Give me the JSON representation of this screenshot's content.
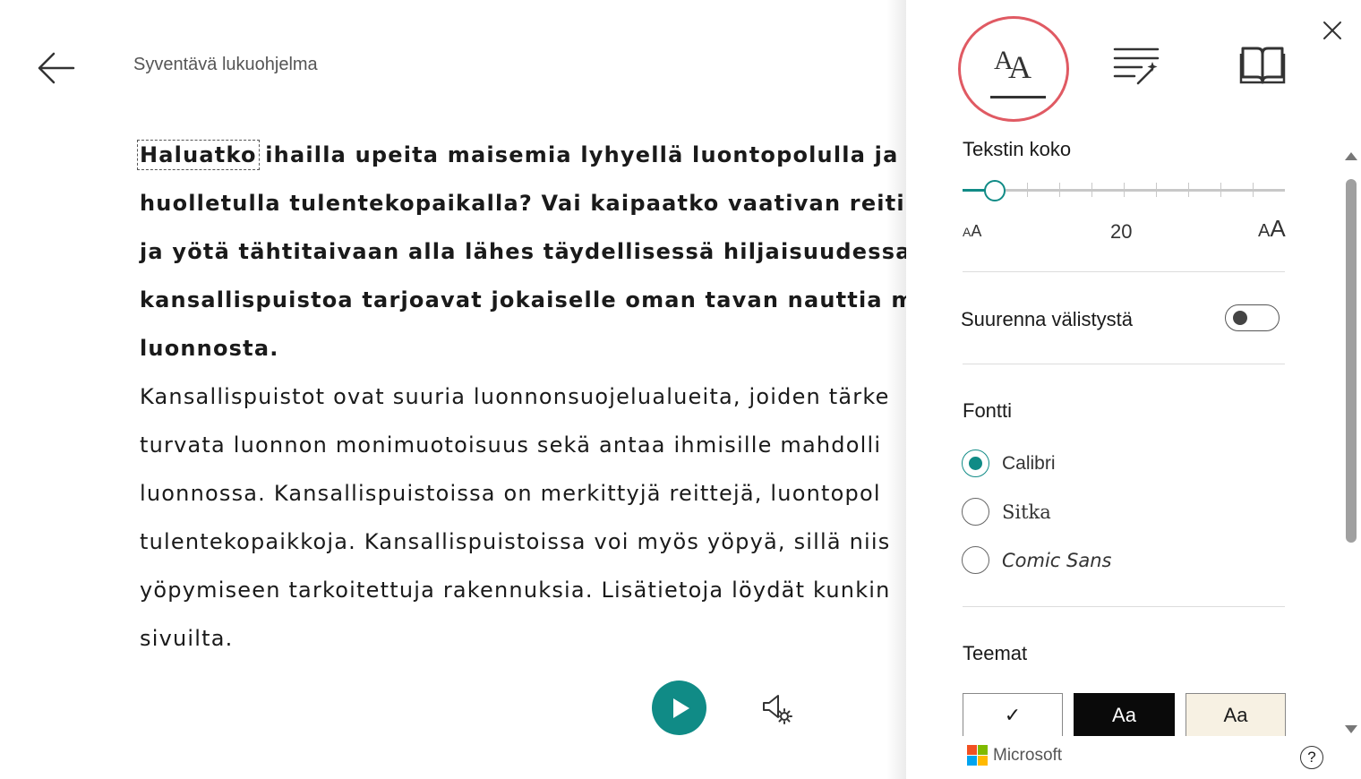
{
  "header": {
    "app_title": "Syventävä lukuohjelma"
  },
  "reader": {
    "highlighted_word": "Haluatko",
    "lines_bold": [
      " ihailla upeita maisemia lyhyellä luontopolulla ja evä",
      "huolletulla tulentekopaikalla? Vai kaipaatko vaativan reitin tu",
      "ja yötä tähtitaivaan alla lähes täydellisessä hiljaisuudessa? Su",
      "kansallispuistoa tarjoavat jokaiselle oman tavan nauttia maan",
      "luonnosta."
    ],
    "lines_normal": [
      "Kansallispuistot ovat suuria luonnonsuojelualueita, joiden tärke",
      "turvata luonnon monimuotoisuus sekä antaa ihmisille mahdolli",
      "luonnossa. Kansallispuistoissa on merkittyjä reittejä, luontopol",
      "tulentekopaikkoja. Kansallispuistoissa voi myös yöpyä, sillä niis",
      "yöpymiseen tarkoitettuja rakennuksia. Lisätietoja löydät kunkin",
      "sivuilta."
    ]
  },
  "panel": {
    "tabs": {
      "text_options_glyph": "AA"
    },
    "text_size": {
      "label": "Tekstin koko",
      "value": 20,
      "value_text": "20",
      "min_glyph": "AA",
      "max_glyph": "AA",
      "fraction": 0.1
    },
    "spacing": {
      "label": "Suurenna välistystä",
      "enabled": false
    },
    "font": {
      "label": "Fontti",
      "options": [
        {
          "label": "Calibri",
          "selected": true
        },
        {
          "label": "Sitka",
          "selected": false
        },
        {
          "label": "Comic Sans",
          "selected": false
        }
      ]
    },
    "themes": {
      "label": "Teemat",
      "swatches": [
        {
          "label": "✓",
          "bg": "#ffffff",
          "fg": "#1a1a1a"
        },
        {
          "label": "Aa",
          "bg": "#0a0a0a",
          "fg": "#ffffff"
        },
        {
          "label": "Aa",
          "bg": "#f7f1e3",
          "fg": "#1a1a1a"
        }
      ]
    },
    "footer": {
      "brand": "Microsoft",
      "help": "?"
    }
  },
  "colors": {
    "accent": "#108b86",
    "highlight_circle": "#e05a63",
    "ms_red": "#f25022",
    "ms_green": "#7fba00",
    "ms_blue": "#00a4ef",
    "ms_yellow": "#ffb900"
  },
  "icons": {
    "back": "arrow-left-icon",
    "close": "close-icon",
    "play": "play-icon",
    "voice_settings": "voice-settings-icon",
    "text_options": "text-size-icon",
    "grammar_options": "grammar-wand-icon",
    "reading_preferences": "book-icon",
    "help": "help-icon"
  }
}
